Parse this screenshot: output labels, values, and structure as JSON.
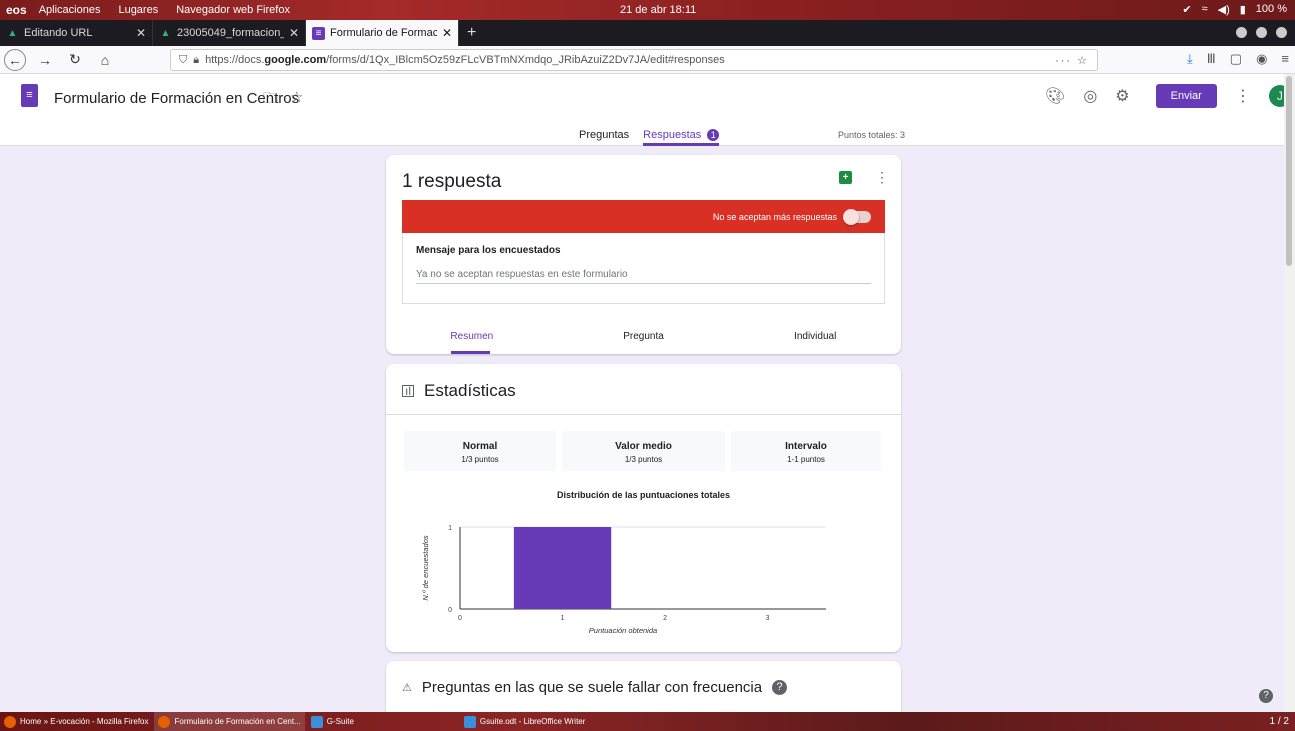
{
  "system": {
    "logo": "eos",
    "menus": [
      "Aplicaciones",
      "Lugares",
      "Navegador web Firefox"
    ],
    "clock": "21 de abr  18:11",
    "battery": "100 %"
  },
  "browser": {
    "tabs": [
      {
        "title": "Editando URL",
        "icon": "A"
      },
      {
        "title": "23005049_formacion_ce",
        "icon": "A"
      },
      {
        "title": "Formulario de Formación",
        "icon": "≡"
      }
    ],
    "url_prefix": "https://docs.",
    "url_domain": "google.com",
    "url_path": "/forms/d/1Qx_IBlcm5Oz59zFLcVBTmNXmdqo_JRibAzuiZ2Dv7JA/edit#responses",
    "url_actions": "··· ☆"
  },
  "form": {
    "title": "Formulario de Formación en Centros",
    "send_label": "Enviar",
    "avatar_letter": "J",
    "tab_questions": "Preguntas",
    "tab_responses": "Respuestas",
    "responses_badge": "1",
    "points_total": "Puntos totales: 3"
  },
  "summary": {
    "count_label": "1 respuesta",
    "not_accepting": "No se aceptan más respuestas",
    "message_label": "Mensaje para los encuestados",
    "message_value": "Ya no se aceptan respuestas en este formulario",
    "subtabs": [
      "Resumen",
      "Pregunta",
      "Individual"
    ]
  },
  "stats": {
    "title": "Estadísticas",
    "boxes": [
      {
        "label": "Normal",
        "value": "1/3 puntos"
      },
      {
        "label": "Valor medio",
        "value": "1/3 puntos"
      },
      {
        "label": "Intervalo",
        "value": "1-1 puntos"
      }
    ]
  },
  "chart_data": {
    "type": "bar",
    "title": "Distribución de las puntuaciones totales",
    "xlabel": "Puntuación obtenida",
    "ylabel": "N.º de encuestados",
    "categories": [
      "0",
      "1",
      "2",
      "3"
    ],
    "values": [
      0,
      1,
      0,
      0
    ],
    "ylim": [
      0,
      1
    ],
    "color": "#673ab7",
    "grid": true
  },
  "frequent": {
    "title": "Preguntas en las que se suele fallar con frecuencia"
  },
  "taskbar": {
    "items": [
      "Home » E-vocación - Mozilla Firefox",
      "Formulario de Formación en Cent...",
      "G-Suite",
      "Gsuite.odt - LibreOffice Writer"
    ],
    "pager": "1 / 2"
  }
}
